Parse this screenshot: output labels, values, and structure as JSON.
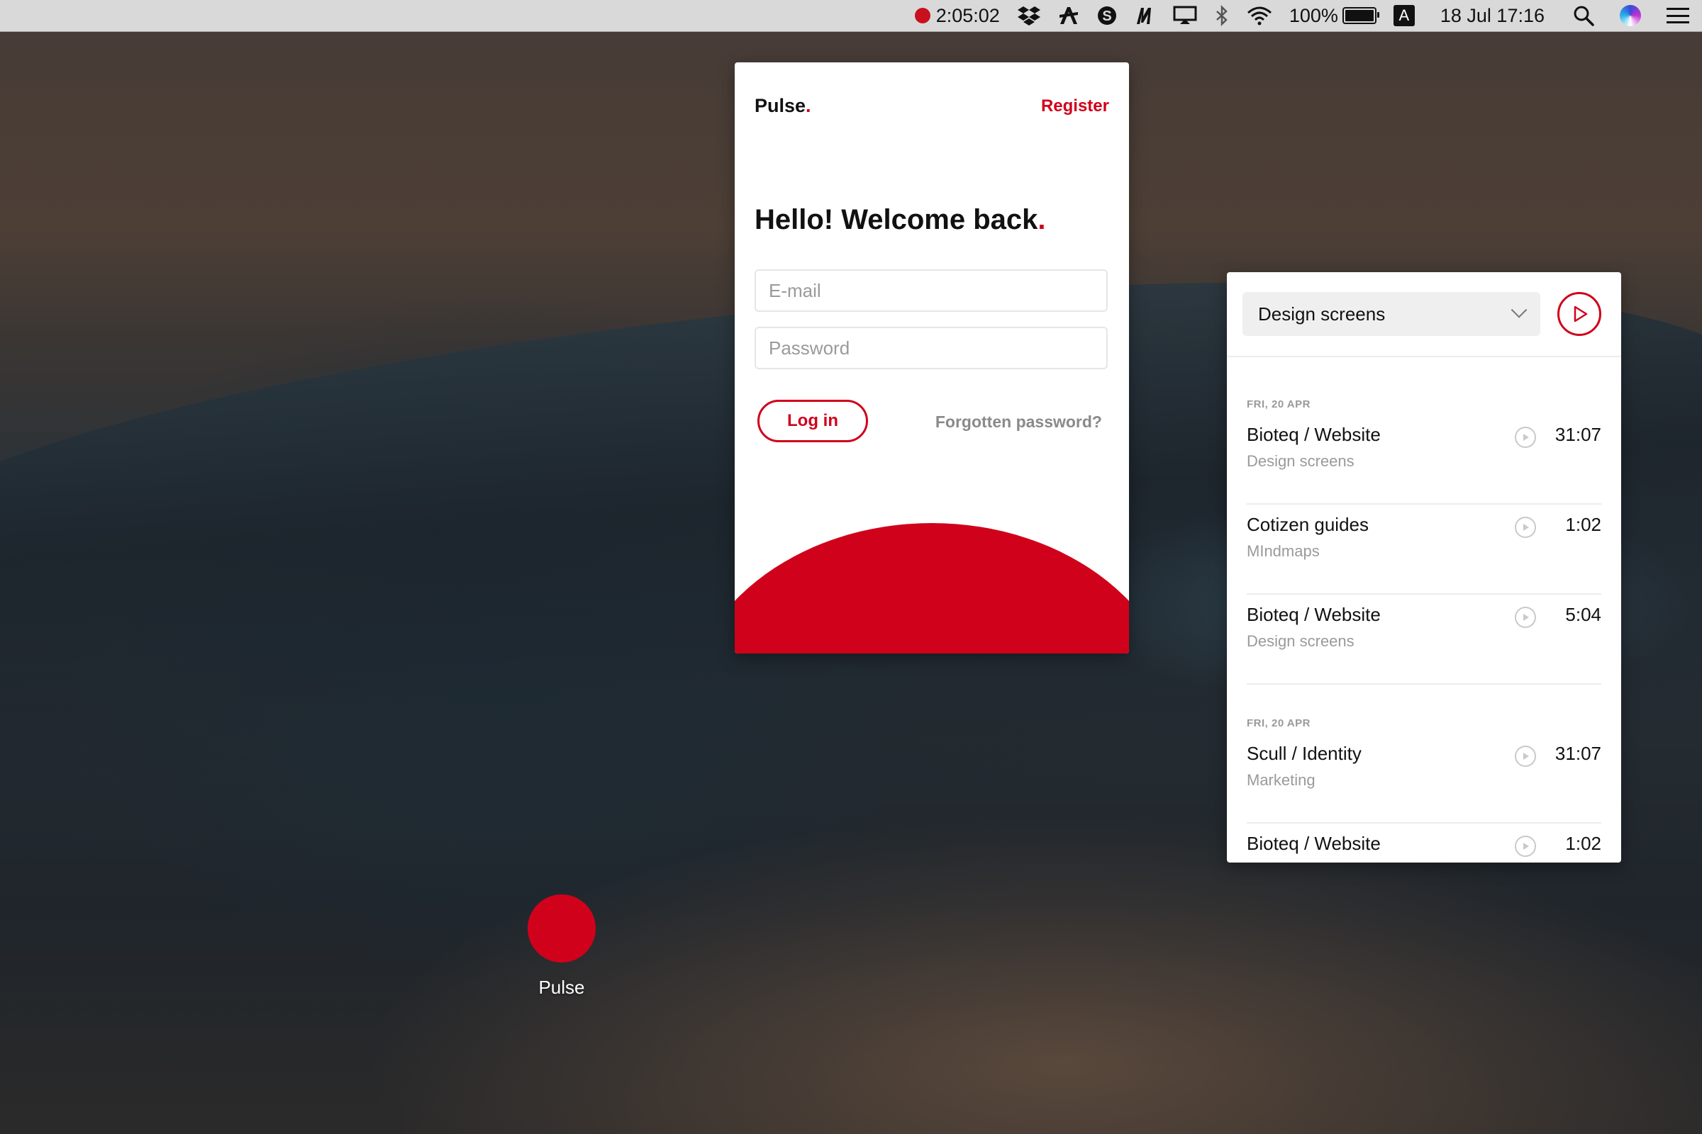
{
  "menubar": {
    "recording_time": "2:05:02",
    "icons": [
      "dropbox-icon",
      "ai-assistant-icon",
      "skype-icon",
      "m-app-icon",
      "display-icon",
      "bluetooth-icon",
      "wifi-icon"
    ],
    "battery_percent": "100%",
    "battery_level": 1.0,
    "input_source": "A",
    "datetime": "18 Jul  17:16"
  },
  "login": {
    "brand": "Pulse",
    "brand_dot": ".",
    "register_label": "Register",
    "heading": "Hello! Welcome back",
    "heading_dot": ".",
    "email_placeholder": "E-mail",
    "password_placeholder": "Password",
    "login_label": "Log in",
    "forgot_label": "Forgotten password?"
  },
  "tracker": {
    "selected_project": "Design screens",
    "groups": [
      {
        "date": "FRI, 20 APR",
        "entries": [
          {
            "title": "Bioteq / Website",
            "subtitle": "Design screens",
            "duration": "31:07"
          },
          {
            "title": "Cotizen guides",
            "subtitle": "MIndmaps",
            "duration": "1:02"
          },
          {
            "title": "Bioteq / Website",
            "subtitle": "Design screens",
            "duration": "5:04"
          }
        ]
      },
      {
        "date": "FRI, 20 APR",
        "entries": [
          {
            "title": "Scull / Identity",
            "subtitle": "Marketing",
            "duration": "31:07"
          },
          {
            "title": "Bioteq / Website",
            "subtitle": "",
            "duration": "1:02"
          }
        ]
      }
    ]
  },
  "desktop": {
    "app_label": "Pulse"
  },
  "colors": {
    "accent": "#d0021b",
    "muted": "#9a9a9a"
  }
}
